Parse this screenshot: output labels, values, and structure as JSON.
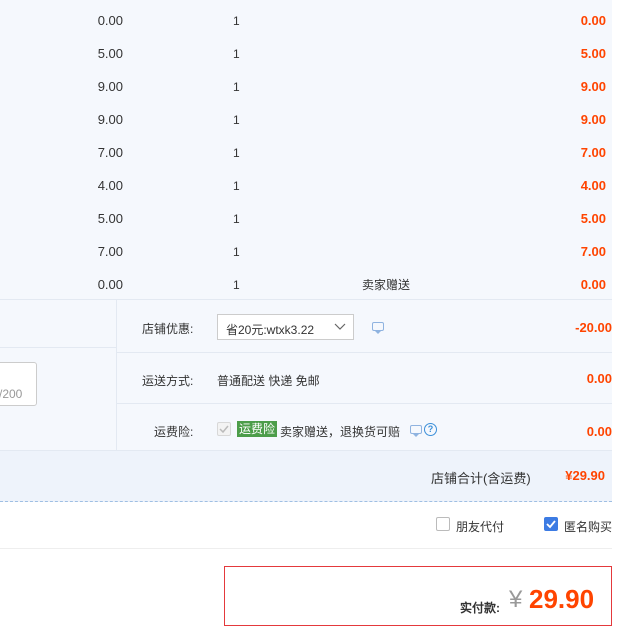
{
  "items": [
    {
      "price": "0.00",
      "qty": "1",
      "note": "",
      "subtotal": "0.00"
    },
    {
      "price": "5.00",
      "qty": "1",
      "note": "",
      "subtotal": "5.00"
    },
    {
      "price": "9.00",
      "qty": "1",
      "note": "",
      "subtotal": "9.00"
    },
    {
      "price": "9.00",
      "qty": "1",
      "note": "",
      "subtotal": "9.00"
    },
    {
      "price": "7.00",
      "qty": "1",
      "note": "",
      "subtotal": "7.00"
    },
    {
      "price": "4.00",
      "qty": "1",
      "note": "",
      "subtotal": "4.00"
    },
    {
      "price": "5.00",
      "qty": "1",
      "note": "",
      "subtotal": "5.00"
    },
    {
      "price": "7.00",
      "qty": "1",
      "note": "",
      "subtotal": "7.00"
    },
    {
      "price": "0.00",
      "qty": "1",
      "note": "卖家赠送",
      "subtotal": "0.00"
    }
  ],
  "discount": {
    "label": "店铺优惠:",
    "selected": "省20元:wtxk3.22",
    "amount": "-20.00"
  },
  "shipping": {
    "label": "运送方式:",
    "method": "普通配送 快递 免邮",
    "amount": "0.00"
  },
  "insurance": {
    "label": "运费险:",
    "tag": "运费险",
    "text": "卖家赠送，退换货可赔",
    "amount": "0.00",
    "help": "?"
  },
  "message": {
    "counter": "/200"
  },
  "store_total": {
    "label": "店铺合计(含运费)",
    "amount": "¥29.90"
  },
  "options": {
    "friend_pay": "朋友代付",
    "anonymous": "匿名购买",
    "anonymous_checked": true,
    "friend_pay_checked": false
  },
  "pay": {
    "label": "实付款:",
    "currency": "¥",
    "amount": "29.90"
  },
  "colors": {
    "accent": "#ff4400",
    "check_blue": "#3c7be3",
    "tag_green": "#4c9d4a"
  }
}
